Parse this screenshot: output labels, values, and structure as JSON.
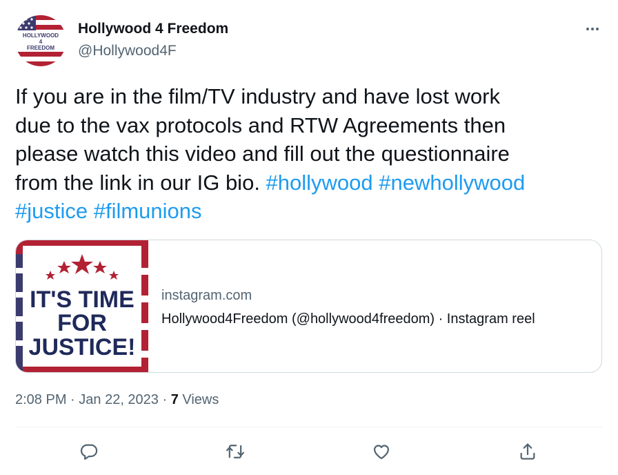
{
  "author": {
    "name": "Hollywood 4 Freedom",
    "handle": "@Hollywood4F",
    "avatar_text": [
      "HOLLYWOOD",
      "4",
      "FREEDOM"
    ]
  },
  "more_icon": "more-horizontal-icon",
  "tweet": {
    "lines": [
      "If you are in the film/TV industry and have lost work",
      "due to the vax protocols and RTW Agreements then",
      "please watch this video and fill out the questionnaire"
    ],
    "line4_text": "from the link in our IG bio. ",
    "hashtags": [
      "#hollywood",
      "#newhollywood",
      "#justice",
      "#filmunions"
    ]
  },
  "card": {
    "domain": "instagram.com",
    "title": "Hollywood4Freedom (@hollywood4freedom) · Instagram reel",
    "thumbnail_text": [
      "IT'S TIME",
      "FOR",
      "JUSTICE!"
    ]
  },
  "meta": {
    "time": "2:08 PM",
    "separator": " · ",
    "date": "Jan 22, 2023",
    "views_count": "7",
    "views_label": " Views"
  },
  "actions": [
    {
      "name": "reply",
      "icon": "reply-icon"
    },
    {
      "name": "retweet",
      "icon": "retweet-icon"
    },
    {
      "name": "like",
      "icon": "like-icon"
    },
    {
      "name": "share",
      "icon": "share-icon"
    }
  ],
  "colors": {
    "text": "#0f1419",
    "secondary": "#536471",
    "link": "#1d9bf0",
    "border": "#cfd9de",
    "flag_red": "#b22234",
    "flag_blue": "#3c3b6e"
  }
}
